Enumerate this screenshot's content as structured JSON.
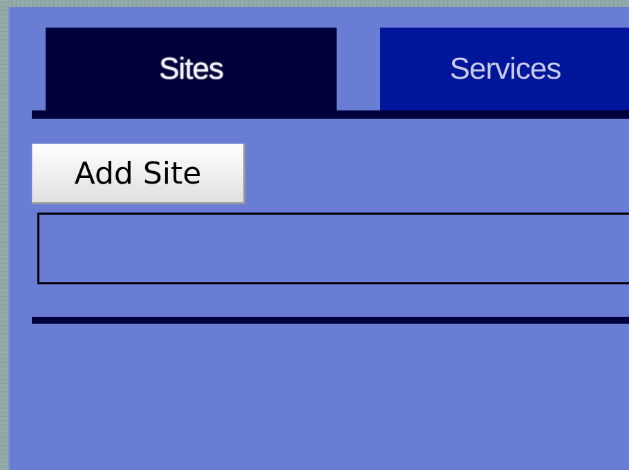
{
  "tabs": [
    {
      "label": "Sites",
      "active": true
    },
    {
      "label": "Services",
      "active": false
    }
  ],
  "toolbar": {
    "add_site_label": "Add Site"
  },
  "colors": {
    "panel_background": "#6a7dd4",
    "active_tab": "#00003a",
    "inactive_tab": "#00169a",
    "rule": "#00003a"
  }
}
